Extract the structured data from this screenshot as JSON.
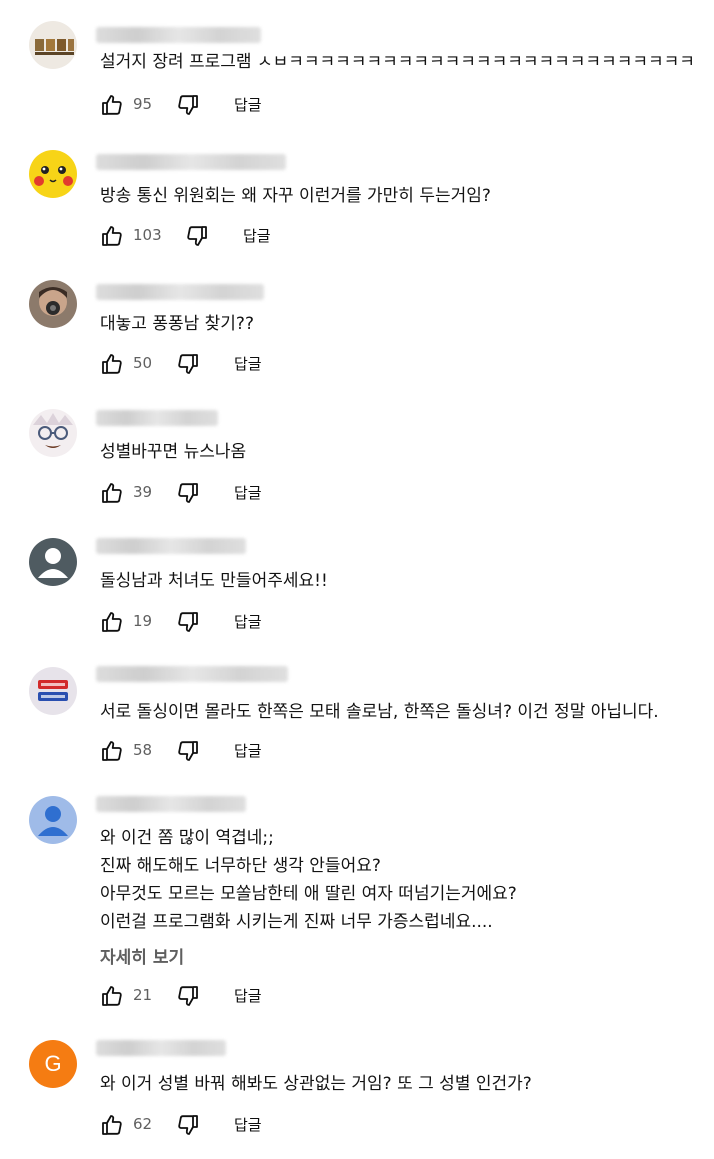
{
  "comments": [
    {
      "text_lines": [
        "설거지 장려 프로그램 ㅅㅂㅋㅋㅋㅋㅋㅋㅋㅋㅋㅋㅋㅋㅋㅋㅋㅋㅋㅋㅋㅋㅋㅋㅋㅋㅋㅋ"
      ],
      "likes": "95",
      "reply": "답글",
      "avatar": "tiles"
    },
    {
      "text_lines": [
        "방송 통신 위원회는 왜 자꾸 이런거를 가만히 두는거임?"
      ],
      "likes": "103",
      "reply": "답글",
      "avatar": "pikachu"
    },
    {
      "text_lines": [
        "대놓고 퐁퐁남 찾기??"
      ],
      "likes": "50",
      "reply": "답글",
      "avatar": "photo"
    },
    {
      "text_lines": [
        "성별바꾸면 뉴스나옴"
      ],
      "likes": "39",
      "reply": "답글",
      "avatar": "anime"
    },
    {
      "text_lines": [
        "돌싱남과 처녀도 만들어주세요!!"
      ],
      "likes": "19",
      "reply": "답글",
      "avatar": "default"
    },
    {
      "text_lines": [
        "서로 돌싱이면 몰라도 한쪽은 모태 솔로남, 한쪽은 돌싱녀? 이건 정말 아닙니다."
      ],
      "likes": "58",
      "reply": "답글",
      "avatar": "badge"
    },
    {
      "text_lines": [
        "와 이건 쫌 많이 역겹네;;",
        "진짜 해도해도 너무하단 생각 안들어요?",
        "아무것도 모르는 모쏠남한테 애 딸린 여자 떠넘기는거에요?",
        "이런걸 프로그램화 시키는게 진짜 너무 가증스럽네요...."
      ],
      "more": "자세히 보기",
      "likes": "21",
      "reply": "답글",
      "avatar": "blue-default"
    },
    {
      "text_lines": [
        "와 이거 성별 바꿔 해봐도 상관없는 거임? 또 그 성별 인건가?"
      ],
      "likes": "62",
      "reply": "답글",
      "avatar": "letter",
      "avatar_letter": "G"
    }
  ]
}
